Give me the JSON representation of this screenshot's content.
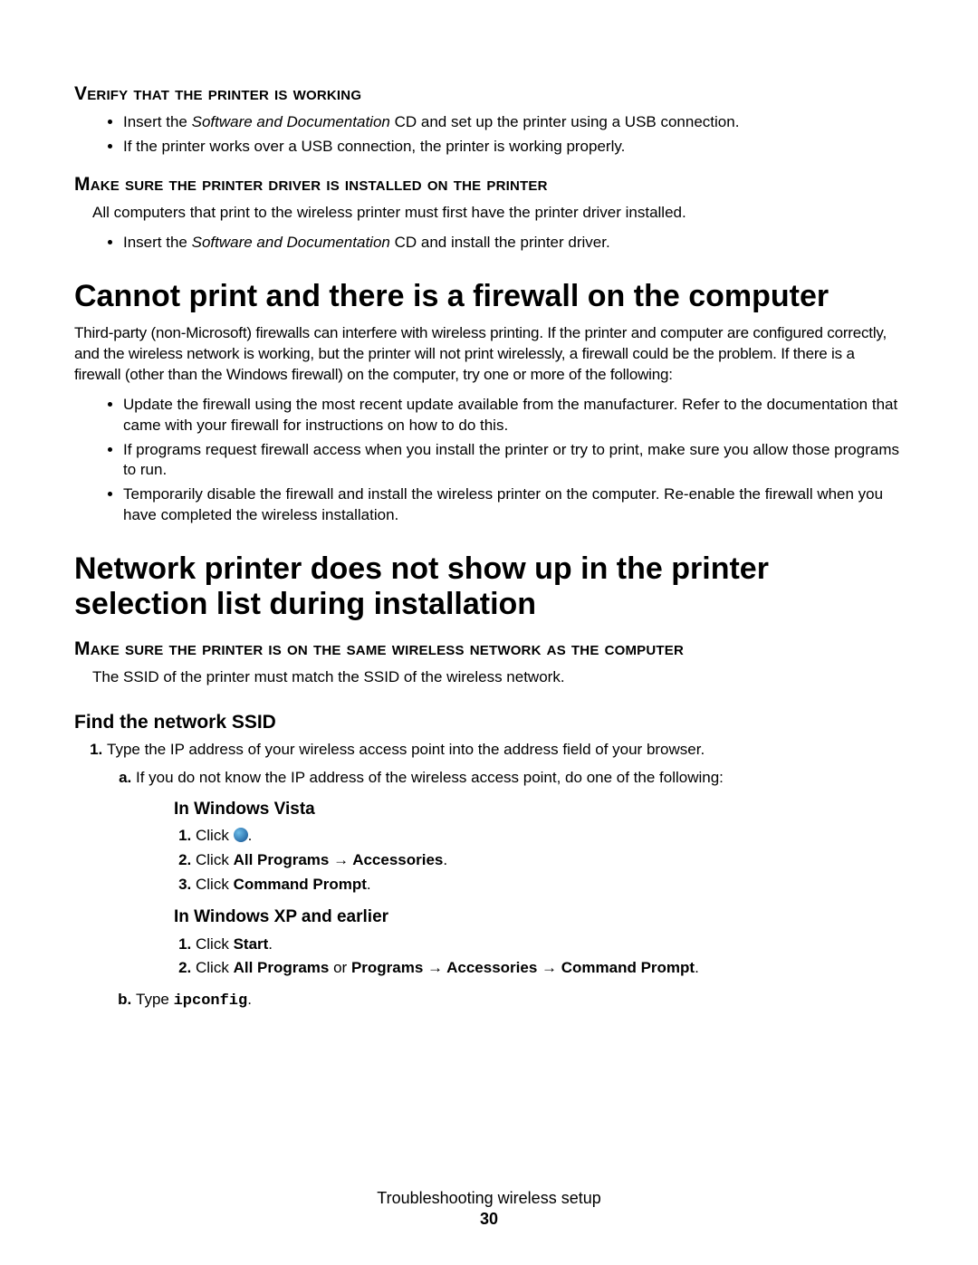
{
  "sec1": {
    "heading": "Verify that the printer is working",
    "b1_pre": "Insert the ",
    "b1_it": "Software and Documentation",
    "b1_post": " CD and set up the printer using a USB connection.",
    "b2": "If the printer works over a USB connection, the printer is working properly."
  },
  "sec2": {
    "heading": "Make sure the printer driver is installed on the printer",
    "para": "All computers that print to the wireless printer must first have the printer driver installed.",
    "b1_pre": "Insert the ",
    "b1_it": "Software and Documentation",
    "b1_post": " CD and install the printer driver."
  },
  "sec3": {
    "heading": "Cannot print and there is a firewall on the computer",
    "para": "Third-party (non-Microsoft) firewalls can interfere with wireless printing. If the printer and computer are configured correctly, and the wireless network is working, but the printer will not print wirelessly, a firewall could be the problem. If there is a firewall (other than the Windows firewall) on the computer, try one or more of the following:",
    "b1": "Update the firewall using the most recent update available from the manufacturer. Refer to the documentation that came with your firewall for instructions on how to do this.",
    "b2": "If programs request firewall access when you install the printer or try to print, make sure you allow those programs to run.",
    "b3": "Temporarily disable the firewall and install the wireless printer on the computer. Re-enable the firewall when you have completed the wireless installation."
  },
  "sec4": {
    "heading": "Network printer does not show up in the printer selection list during installation",
    "sub1": "Make sure the printer is on the same wireless network as the computer",
    "para1": "The SSID of the printer must match the SSID of the wireless network.",
    "sub2": "Find the network SSID",
    "step1": "Type the IP address of your wireless access point into the address field of your browser.",
    "step1a": "If you do not know the IP address of the wireless access point, do one of the following:",
    "vista_h": "In Windows Vista",
    "vista_s1_pre": "Click ",
    "vista_s1_post": ".",
    "vista_s2_pre": "Click ",
    "vista_s2_b": "All Programs  →  Accessories",
    "vista_s2_post": ".",
    "vista_s3_pre": "Click ",
    "vista_s3_b": "Command Prompt",
    "vista_s3_post": ".",
    "xp_h": "In Windows XP and earlier",
    "xp_s1_pre": "Click ",
    "xp_s1_b": "Start",
    "xp_s1_post": ".",
    "xp_s2_pre": "Click ",
    "xp_s2_b1": "All Programs",
    "xp_s2_mid": " or ",
    "xp_s2_b2": "Programs  →  Accessories  →  Command Prompt",
    "xp_s2_post": ".",
    "step1b_pre": "Type ",
    "step1b_code": "ipconfig",
    "step1b_post": "."
  },
  "footer": {
    "title": "Troubleshooting wireless setup",
    "page": "30"
  }
}
